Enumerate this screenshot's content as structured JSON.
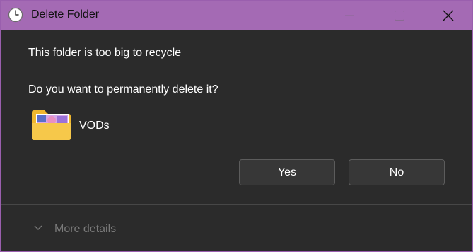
{
  "window": {
    "title": "Delete Folder",
    "accent_color": "#a46ab4"
  },
  "titlebar": {
    "app_icon": "clock-icon",
    "minimize_icon": "minimize-icon",
    "maximize_icon": "maximize-icon",
    "close_icon": "close-icon"
  },
  "dialog": {
    "message_primary": "This folder is too big to recycle",
    "message_question": "Do you want to permanently delete it?",
    "item": {
      "icon": "folder-icon",
      "name": "VODs"
    },
    "buttons": {
      "yes_label": "Yes",
      "no_label": "No"
    }
  },
  "footer": {
    "expander_icon": "chevron-down-icon",
    "more_details_label": "More details"
  }
}
